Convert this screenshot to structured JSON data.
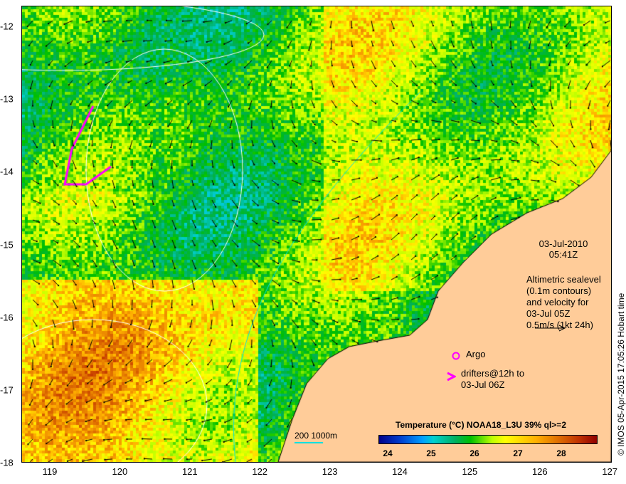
{
  "map": {
    "x_ticks": [
      "119",
      "120",
      "121",
      "122",
      "123",
      "124",
      "125",
      "126",
      "127"
    ],
    "y_ticks": [
      "-12",
      "-13",
      "-14",
      "-15",
      "-16",
      "-17",
      "-18"
    ],
    "date": "03-Jul-2010",
    "time": "05:41Z",
    "altimetry_lines": [
      "Altimetric sealevel",
      "(0.1m contours)",
      "and velocity for",
      "03-Jul 05Z",
      "0.5m/s (1kt 24h)"
    ],
    "argo_label": "Argo",
    "drifters_lines": [
      "drifters@12h to",
      "03-Jul 06Z"
    ],
    "scale_label": "200  1000m",
    "credit": "© IMOS 05-Apr-2015 17:05:26 Hobart time"
  },
  "colorbar": {
    "title": "Temperature (°C) NOAA18_L3U 39% ql>=2",
    "labels": [
      "24",
      "25",
      "26",
      "27",
      "28"
    ]
  },
  "colors": {
    "land": "#ffcc99",
    "argo": "#ff00ff",
    "isobath": "#00e0e0"
  }
}
